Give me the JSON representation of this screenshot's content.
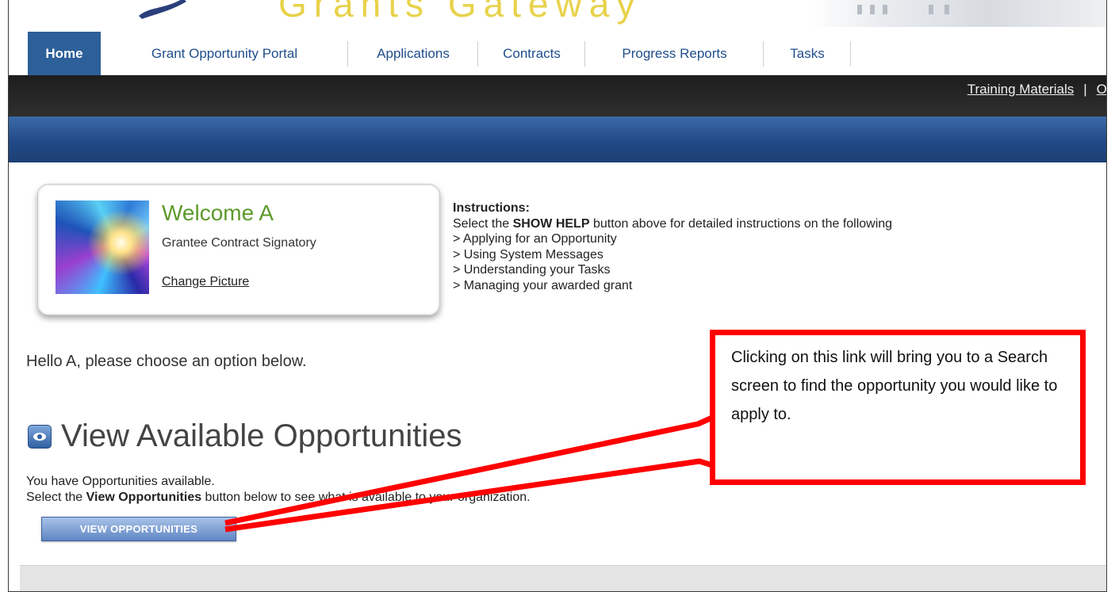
{
  "header": {
    "brand_text": "Grants Gateway",
    "logo_icon": "brush-stroke-logo-icon",
    "banner_image": "capitol-building-image"
  },
  "tabs": [
    {
      "label": "Home",
      "active": true
    },
    {
      "label": "Grant Opportunity Portal",
      "active": false
    },
    {
      "label": "Applications",
      "active": false
    },
    {
      "label": "Contracts",
      "active": false
    },
    {
      "label": "Progress Reports",
      "active": false
    },
    {
      "label": "Tasks",
      "active": false
    }
  ],
  "top_links": {
    "training": "Training Materials",
    "separator": "|",
    "org": "Org"
  },
  "welcome": {
    "greeting": "Welcome A",
    "role": "Grantee Contract Signatory",
    "change_picture": "Change Picture"
  },
  "instructions": {
    "title": "Instructions:",
    "intro_pre": "Select the ",
    "intro_bold": "SHOW HELP",
    "intro_post": " button above for detailed instructions on the following",
    "items": [
      "> Applying for an Opportunity",
      "> Using System Messages",
      "> Understanding your Tasks",
      "> Managing your awarded grant"
    ]
  },
  "hello_text": "Hello A, please choose an option below.",
  "opportunities": {
    "heading": "View Available Opportunities",
    "available_text": "You have Opportunities available.",
    "select_pre": "Select the ",
    "select_bold": "View Opportunities",
    "select_post": " button below to see what is available to your organization.",
    "button_label": "VIEW OPPORTUNITIES"
  },
  "callout": {
    "text": "Clicking on this link will bring you to a Search screen to find the opportunity you would like to apply to.",
    "border_color": "#ff0000"
  },
  "colors": {
    "active_tab": "#2d5f99",
    "tab_text": "#1f4e8c",
    "welcome_name": "#5d9a2b",
    "blue_bar": "#224a86",
    "dark_bar": "#262626"
  }
}
